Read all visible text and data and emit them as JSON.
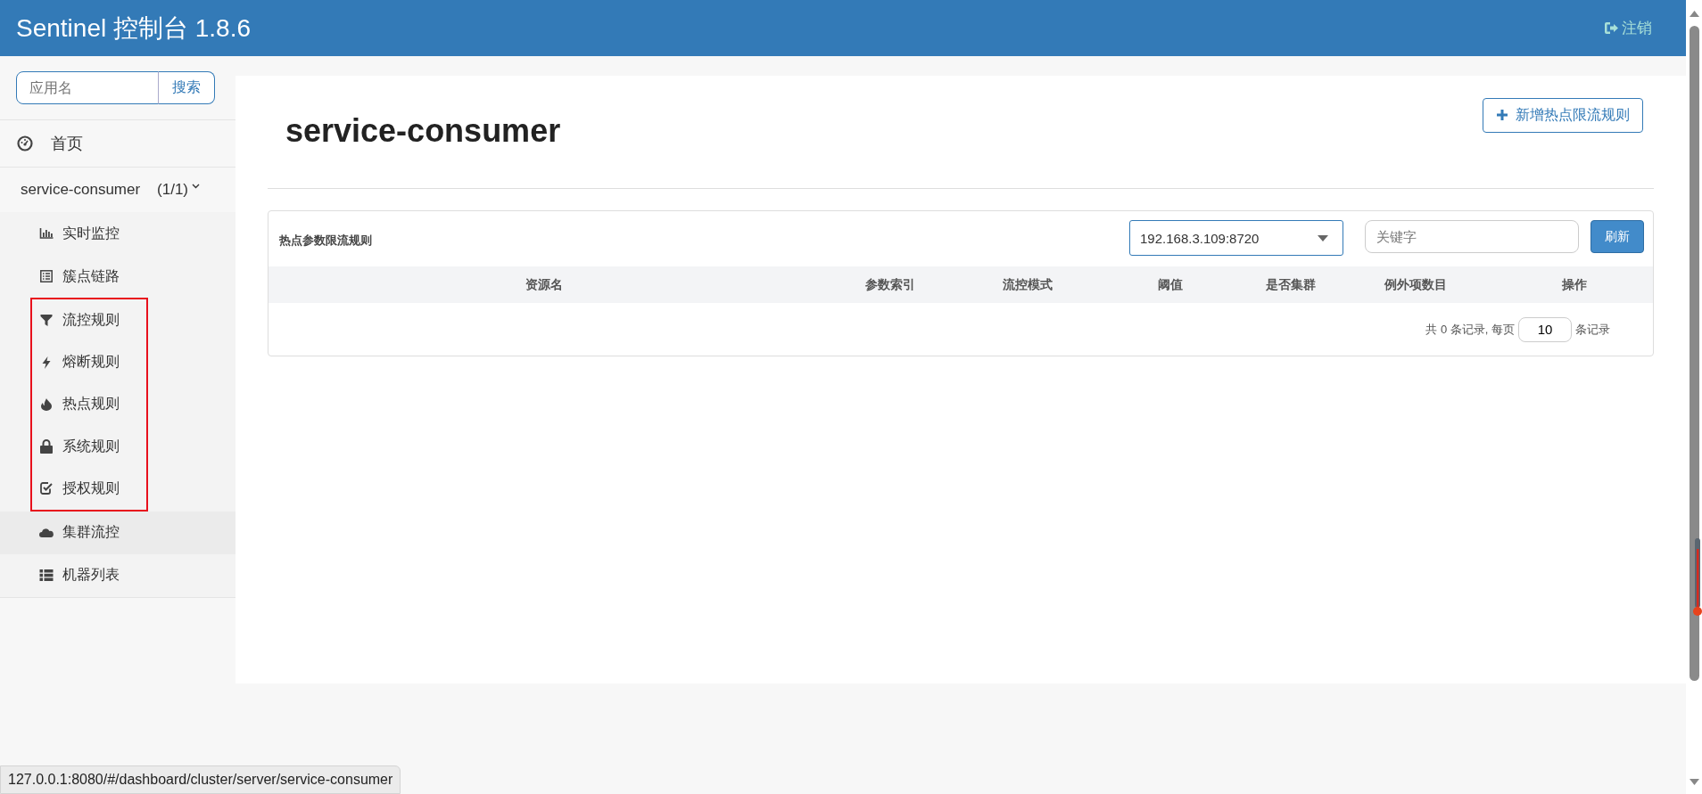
{
  "header": {
    "title": "Sentinel 控制台 1.8.6",
    "logout": "注销"
  },
  "sidebar": {
    "search": {
      "placeholder": "应用名",
      "button": "搜索"
    },
    "home": {
      "label": "首页",
      "selected": false
    },
    "app": {
      "name": "service-consumer",
      "count": "(1/1)",
      "expanded": true,
      "items": [
        {
          "label": "实时监控",
          "selected": false,
          "annotated": false
        },
        {
          "label": "簇点链路",
          "selected": false,
          "annotated": false
        },
        {
          "label": "流控规则",
          "selected": false,
          "annotated": true
        },
        {
          "label": "熔断规则",
          "selected": false,
          "annotated": true
        },
        {
          "label": "热点规则",
          "selected": false,
          "annotated": true
        },
        {
          "label": "系统规则",
          "selected": false,
          "annotated": true
        },
        {
          "label": "授权规则",
          "selected": false,
          "annotated": true
        },
        {
          "label": "集群流控",
          "selected": true,
          "annotated": false
        },
        {
          "label": "机器列表",
          "selected": false,
          "annotated": false
        }
      ]
    }
  },
  "main": {
    "title": "service-consumer",
    "add_button": "新增热点限流规则",
    "card": {
      "title": "热点参数限流规则",
      "machine": "192.168.3.109:8720",
      "keyword_placeholder": "关键字",
      "refresh": "刷新",
      "columns": [
        "资源名",
        "参数索引",
        "流控模式",
        "阈值",
        "是否集群",
        "例外项数目",
        "操作"
      ],
      "pagination": {
        "total": "共 0 条记录, 每页",
        "page_size": "10",
        "suffix": "条记录"
      }
    }
  },
  "status_bar": {
    "url": "127.0.0.1:8080/#/dashboard/cluster/server/service-consumer"
  }
}
